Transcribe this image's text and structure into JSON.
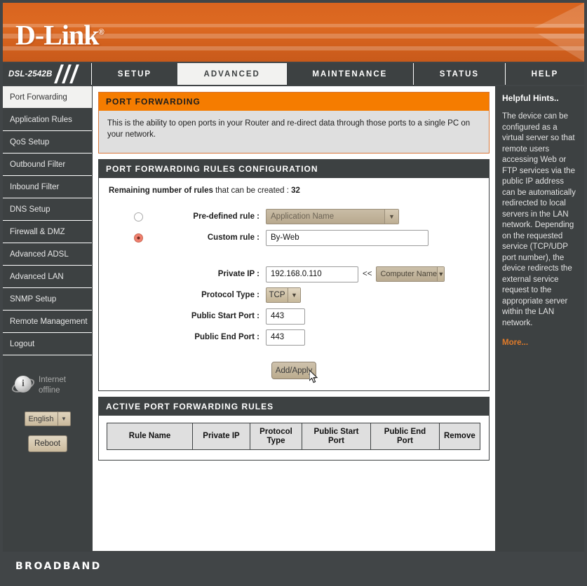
{
  "banner": {
    "brand": "D-Link",
    "trademark": "®"
  },
  "nav": {
    "model": "DSL-2542B",
    "tabs": [
      {
        "label": "SETUP",
        "active": false
      },
      {
        "label": "ADVANCED",
        "active": true
      },
      {
        "label": "MAINTENANCE",
        "active": false
      },
      {
        "label": "STATUS",
        "active": false
      },
      {
        "label": "HELP",
        "active": false
      }
    ]
  },
  "sidebar": {
    "items": [
      {
        "label": "Port Forwarding",
        "active": true
      },
      {
        "label": "Application Rules",
        "active": false
      },
      {
        "label": "QoS Setup",
        "active": false
      },
      {
        "label": "Outbound Filter",
        "active": false
      },
      {
        "label": "Inbound Filter",
        "active": false
      },
      {
        "label": "DNS Setup",
        "active": false
      },
      {
        "label": "Firewall & DMZ",
        "active": false
      },
      {
        "label": "Advanced ADSL",
        "active": false
      },
      {
        "label": "Advanced LAN",
        "active": false
      },
      {
        "label": "SNMP Setup",
        "active": false
      },
      {
        "label": "Remote Management",
        "active": false
      },
      {
        "label": "Logout",
        "active": false
      }
    ],
    "status": {
      "line1": "Internet",
      "line2": "offline",
      "icon_letter": "i"
    },
    "language": {
      "value": "English",
      "arrow": "▼"
    },
    "reboot_label": "Reboot"
  },
  "main": {
    "page_title": "PORT FORWARDING",
    "description": "This is the ability to open ports in your Router and re-direct data through those ports to a single PC on your network.",
    "config_section_title": "PORT FORWARDING RULES CONFIGURATION",
    "remaining_label": "Remaining number of rules",
    "remaining_rest": "that can be created :",
    "remaining_count": "32",
    "form": {
      "predefined_label": "Pre-defined rule :",
      "predefined_value": "Application Name",
      "predefined_selected": false,
      "custom_label": "Custom rule :",
      "custom_value": "By-Web",
      "custom_selected": true,
      "private_ip_label": "Private IP :",
      "private_ip_value": "192.168.0.110",
      "ip_separator": "<<",
      "computer_name_value": "Computer Name",
      "protocol_label": "Protocol Type :",
      "protocol_value": "TCP",
      "public_start_label": "Public Start Port :",
      "public_start_value": "443",
      "public_end_label": "Public End Port :",
      "public_end_value": "443",
      "apply_label": "Add/Apply",
      "dropdown_arrow": "▼"
    },
    "active_rules": {
      "section_title": "ACTIVE PORT FORWARDING RULES",
      "columns": [
        "Rule Name",
        "Private IP",
        "Protocol Type",
        "Public Start Port",
        "Public End Port",
        "Remove"
      ],
      "rows": []
    }
  },
  "hints": {
    "title": "Helpful Hints..",
    "body": "The device can be configured as a virtual server so that remote users accessing Web or FTP services via the public IP address can be automatically redirected to local servers in the LAN network. Depending on the requested service (TCP/UDP port number), the device redirects the external service request to the appropriate server within the LAN network.",
    "more": "More..."
  },
  "footer": {
    "brand": "BROADBAND"
  },
  "colors": {
    "orange_accent": "#f57c00",
    "banner_orange": "#d9641f",
    "dark_chrome": "#3d4142",
    "panel_grey": "#dfdfdf",
    "hint_link": "#e07b2a"
  }
}
